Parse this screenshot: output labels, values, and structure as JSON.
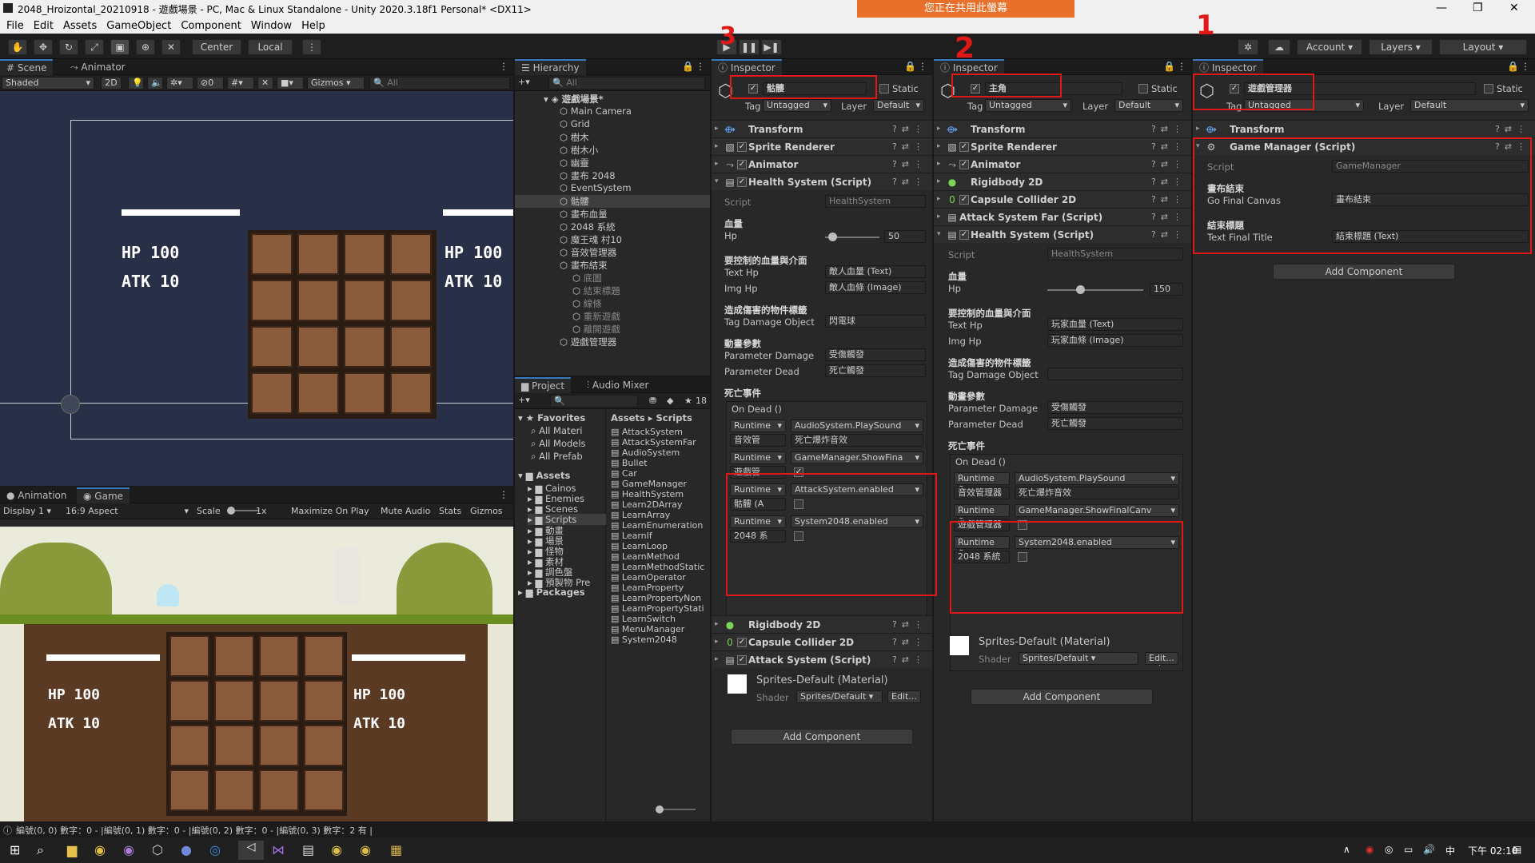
{
  "window": {
    "title": "2048_Hroizontal_20210918 - 遊戲場景 - PC, Mac & Linux Standalone - Unity 2020.3.18f1 Personal* <DX11>",
    "share_banner": "您正在共用此螢幕",
    "min": "—",
    "max": "❐",
    "close": "✕"
  },
  "menu": [
    "File",
    "Edit",
    "Assets",
    "GameObject",
    "Component",
    "Window",
    "Help"
  ],
  "toolbar": {
    "center": "Center",
    "local": "Local",
    "account": "Account",
    "layers": "Layers",
    "layout": "Layout"
  },
  "scene": {
    "tab_scene": "Scene",
    "tab_animator": "Animator",
    "shaded": "Shaded",
    "mode2d": "2D",
    "gizmos": "Gizmos",
    "search_placeholder": "All",
    "layer_count": "0",
    "hp_left": "HP 100",
    "atk_left": "ATK 10",
    "hp_right": "HP 100",
    "atk_right": "ATK 10"
  },
  "game": {
    "tab_animation": "Animation",
    "tab_game": "Game",
    "display": "Display 1",
    "aspect": "16:9 Aspect",
    "scale_label": "Scale",
    "scale_value": "1x",
    "maximize": "Maximize On Play",
    "mute": "Mute Audio",
    "stats": "Stats",
    "gizmos": "Gizmos",
    "hp_left": "HP 100",
    "atk_left": "ATK 10",
    "hp_right": "HP 100",
    "atk_right": "ATK 10"
  },
  "hierarchy": {
    "tab": "Hierarchy",
    "search_placeholder": "All",
    "root": "遊戲場景*",
    "items": [
      {
        "label": "Main Camera",
        "indent": 1
      },
      {
        "label": "Grid",
        "indent": 1
      },
      {
        "label": "樹木",
        "indent": 1
      },
      {
        "label": "樹木小",
        "indent": 1
      },
      {
        "label": "幽靈",
        "indent": 1
      },
      {
        "label": "畫布 2048",
        "indent": 1
      },
      {
        "label": "EventSystem",
        "indent": 1
      },
      {
        "label": "骷髏",
        "indent": 1,
        "selected": true
      },
      {
        "label": "畫布血量",
        "indent": 1
      },
      {
        "label": "2048 系統",
        "indent": 1
      },
      {
        "label": "魔王魂 村10",
        "indent": 1
      },
      {
        "label": "音效管理器",
        "indent": 1
      },
      {
        "label": "畫布結束",
        "indent": 1
      },
      {
        "label": "底圖",
        "indent": 2
      },
      {
        "label": "結束標題",
        "indent": 2
      },
      {
        "label": "線條",
        "indent": 2
      },
      {
        "label": "重新遊戲",
        "indent": 2
      },
      {
        "label": "離開遊戲",
        "indent": 2
      },
      {
        "label": "遊戲管理器",
        "indent": 1
      }
    ]
  },
  "project": {
    "tab_project": "Project",
    "tab_audio": "Audio Mixer",
    "hidden_count": "18",
    "breadcrumb_assets": "Assets",
    "breadcrumb_scripts": "Scripts",
    "favorites": "Favorites",
    "fav_items": [
      "All Materi",
      "All Models",
      "All Prefab"
    ],
    "assets": "Assets",
    "folders": [
      "Cainos",
      "Enemies",
      "Scenes",
      "Scripts",
      "動畫",
      "場景",
      "怪物",
      "素材",
      "調色盤",
      "預製物 Pre"
    ],
    "packages": "Packages",
    "scripts": [
      "AttackSystem",
      "AttackSystemFar",
      "AudioSystem",
      "Bullet",
      "Car",
      "GameManager",
      "HealthSystem",
      "Learn2DArray",
      "LearnArray",
      "LearnEnumeration",
      "LearnIf",
      "LearnLoop",
      "LearnMethod",
      "LearnMethodStatic",
      "LearnOperator",
      "LearnProperty",
      "LearnPropertyNon",
      "LearnPropertyStati",
      "LearnSwitch",
      "MenuManager",
      "System2048"
    ]
  },
  "insp1": {
    "tab": "Inspector",
    "name": "骷髏",
    "static": "Static",
    "tag_label": "Tag",
    "tag": "Untagged",
    "layer_label": "Layer",
    "layer": "Default",
    "components": {
      "transform": "Transform",
      "sprite": "Sprite Renderer",
      "animator": "Animator",
      "health": "Health System (Script)",
      "rigidbody": "Rigidbody 2D",
      "capsule": "Capsule Collider 2D",
      "attack": "Attack System (Script)"
    },
    "script_label": "Script",
    "script_value": "HealthSystem",
    "h_hp": "血量",
    "hp_label": "Hp",
    "hp_value": "50",
    "h_ui": "要控制的血量與介面",
    "text_hp_label": "Text Hp",
    "text_hp_value": "敵人血量 (Text)",
    "img_hp_label": "Img Hp",
    "img_hp_value": "敵人血條 (Image)",
    "h_tag": "造成傷害的物件標籤",
    "tag_damage_label": "Tag Damage Object",
    "tag_damage_value": "閃電球",
    "h_param": "動畫參數",
    "param_damage_label": "Parameter Damage",
    "param_damage_value": "受傷觸發",
    "param_dead_label": "Parameter Dead",
    "param_dead_value": "死亡觸發",
    "h_dead": "死亡事件",
    "on_dead": "On Dead ()",
    "events": [
      {
        "mode": "Runtime",
        "func": "AudioSystem.PlaySound",
        "obj": "音效管",
        "arg": "死亡爆炸音效"
      },
      {
        "mode": "Runtime",
        "func": "GameManager.ShowFina",
        "obj": "遊戲管",
        "arg": "✓"
      },
      {
        "mode": "Runtime",
        "func": "AttackSystem.enabled",
        "obj": "骷髏 (A",
        "arg": ""
      },
      {
        "mode": "Runtime",
        "func": "System2048.enabled",
        "obj": "2048 系",
        "arg": ""
      }
    ],
    "material": "Sprites-Default (Material)",
    "shader_label": "Shader",
    "shader": "Sprites/Default",
    "edit": "Edit...",
    "add_component": "Add Component"
  },
  "insp2": {
    "tab": "Inspector",
    "name": "主角",
    "static": "Static",
    "tag_label": "Tag",
    "tag": "Untagged",
    "layer_label": "Layer",
    "layer": "Default",
    "components": {
      "transform": "Transform",
      "sprite": "Sprite Renderer",
      "animator": "Animator",
      "rigidbody": "Rigidbody 2D",
      "capsule": "Capsule Collider 2D",
      "attackfar": "Attack System Far (Script)",
      "health": "Health System (Script)"
    },
    "script_label": "Script",
    "script_value": "HealthSystem",
    "h_hp": "血量",
    "hp_label": "Hp",
    "hp_value": "150",
    "h_ui": "要控制的血量與介面",
    "text_hp_label": "Text Hp",
    "text_hp_value": "玩家血量 (Text)",
    "img_hp_label": "Img Hp",
    "img_hp_value": "玩家血條 (Image)",
    "h_tag": "造成傷害的物件標籤",
    "tag_damage_label": "Tag Damage Object",
    "tag_damage_value": "",
    "h_param": "動畫參數",
    "param_damage_label": "Parameter Damage",
    "param_damage_value": "受傷觸發",
    "param_dead_label": "Parameter Dead",
    "param_dead_value": "死亡觸發",
    "h_dead": "死亡事件",
    "on_dead": "On Dead ()",
    "events": [
      {
        "mode": "Runtime On",
        "func": "AudioSystem.PlaySound",
        "obj": "音效管理器",
        "arg": "死亡爆炸音效"
      },
      {
        "mode": "Runtime On",
        "func": "GameManager.ShowFinalCanv",
        "obj": "遊戲管理器",
        "arg": ""
      },
      {
        "mode": "Runtime On",
        "func": "System2048.enabled",
        "obj": "2048 系統",
        "arg": ""
      }
    ],
    "material": "Sprites-Default (Material)",
    "shader_label": "Shader",
    "shader": "Sprites/Default",
    "edit": "Edit...",
    "add_component": "Add Component"
  },
  "insp3": {
    "tab": "Inspector",
    "name": "遊戲管理器",
    "static": "Static",
    "tag_label": "Tag",
    "tag": "Untagged",
    "layer_label": "Layer",
    "layer": "Default",
    "transform": "Transform",
    "gm": "Game Manager (Script)",
    "script_label": "Script",
    "script_value": "GameManager",
    "h_canvas": "畫布結束",
    "go_label": "Go Final Canvas",
    "go_value": "畫布結束",
    "h_title": "結束標題",
    "tf_label": "Text Final Title",
    "tf_value": "結束標題 (Text)",
    "add_component": "Add Component"
  },
  "annotations": {
    "n1": "1",
    "n2": "2",
    "n3": "3"
  },
  "status": {
    "text": "編號(0, 0) 數字：0 - |編號(0, 1) 數字：0 - |編號(0, 2) 數字：0 - |編號(0, 3) 數字：2 有 |"
  },
  "taskbar": {
    "time": "下午 02:10",
    "ime": "中"
  }
}
